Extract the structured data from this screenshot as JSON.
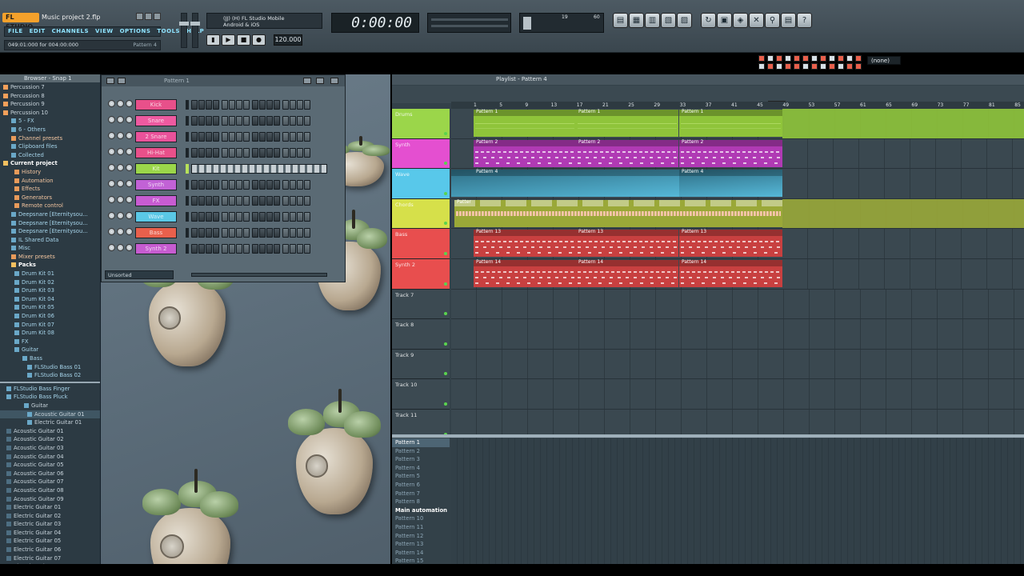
{
  "app": {
    "logo": "FL STUDIO",
    "project_title": "Music project 2.flp",
    "menu": [
      "FILE",
      "EDIT",
      "CHANNELS",
      "VIEW",
      "OPTIONS",
      "TOOLS",
      "HELP"
    ],
    "hint": "049:01:000 for 004:00:000",
    "hint_right": "Pattern 4"
  },
  "transport": {
    "device": "(JJ) (H) FL Studio Mobile\nAndroid & iOS",
    "tempo": "120.000",
    "time": "0:00:00",
    "cpu_left": "19",
    "cpu_right": "60"
  },
  "toolbar": {
    "icons": [
      "piano-icon",
      "mixer-icon",
      "channel-icon",
      "step-icon",
      "playlist-icon",
      "undo-icon",
      "save-icon",
      "plugin-icon",
      "tools-icon",
      "search-icon",
      "clipboard-icon",
      "help-icon"
    ],
    "glyphs": [
      "▤",
      "▦",
      "▥",
      "▧",
      "▨",
      "↻",
      "▣",
      "◈",
      "✕",
      "⚲",
      "▤",
      "?"
    ]
  },
  "snap": {
    "value": "(none)"
  },
  "browser": {
    "header": "Browser - Snap 1",
    "items": [
      {
        "label": "Percussion 7",
        "style": "file"
      },
      {
        "label": "Percussion 8",
        "style": "file"
      },
      {
        "label": "Percussion 9",
        "style": "file"
      },
      {
        "label": "Percussion 10",
        "style": "file"
      },
      {
        "label": "5 - FX",
        "style": "dark"
      },
      {
        "label": "6 - Others",
        "style": "dark"
      },
      {
        "label": "Channel presets",
        "style": "hl"
      },
      {
        "label": "Clipboard files",
        "style": "dark"
      },
      {
        "label": "Collected",
        "style": "dark"
      },
      {
        "label": "Current project",
        "style": "bold"
      },
      {
        "label": "History",
        "style": "hl"
      },
      {
        "label": "Automation",
        "style": "hl"
      },
      {
        "label": "Effects",
        "style": "hl"
      },
      {
        "label": "Generators",
        "style": "hl"
      },
      {
        "label": "Remote control",
        "style": "hl"
      },
      {
        "label": "Deepsnare [Eternitysou...",
        "style": "dark"
      },
      {
        "label": "Deepsnare [Eternitysou...",
        "style": "dark"
      },
      {
        "label": "Deepsnare [Eternitysou...",
        "style": "dark"
      },
      {
        "label": "IL Shared Data",
        "style": "dark"
      },
      {
        "label": "Misc",
        "style": "dark"
      },
      {
        "label": "Mixer presets",
        "style": "hl"
      },
      {
        "label": "Packs",
        "style": "bold"
      },
      {
        "label": "Drum Kit 01",
        "style": "dark"
      },
      {
        "label": "Drum Kit 02",
        "style": "dark"
      },
      {
        "label": "Drum Kit 03",
        "style": "dark"
      },
      {
        "label": "Drum Kit 04",
        "style": "dark"
      },
      {
        "label": "Drum Kit 05",
        "style": "dark"
      },
      {
        "label": "Drum Kit 06",
        "style": "dark"
      },
      {
        "label": "Drum Kit 07",
        "style": "dark"
      },
      {
        "label": "Drum Kit 08",
        "style": "dark"
      },
      {
        "label": "FX",
        "style": "dark"
      },
      {
        "label": "Guitar",
        "style": "dark"
      },
      {
        "label": "Bass",
        "style": "dark"
      },
      {
        "label": "FLStudio Bass 01",
        "style": "dark"
      },
      {
        "label": "FLStudio Bass 02",
        "style": "dark"
      }
    ],
    "items2": [
      "FLStudio Bass Finger",
      "FLStudio Bass Pluck",
      "Guitar",
      "Acoustic Guitar 01",
      "Electric Guitar 01",
      "Acoustic Guitar 01",
      "Acoustic Guitar 02",
      "Acoustic Guitar 03",
      "Acoustic Guitar 04",
      "Acoustic Guitar 05",
      "Acoustic Guitar 06",
      "Acoustic Guitar 07",
      "Acoustic Guitar 08",
      "Acoustic Guitar 09",
      "Electric Guitar 01",
      "Electric Guitar 02",
      "Electric Guitar 03",
      "Electric Guitar 04",
      "Electric Guitar 05",
      "Electric Guitar 06",
      "Electric Guitar 07",
      "Electric Guitar 08",
      "Electric Guitar 09"
    ]
  },
  "rack": {
    "title": "Pattern 1",
    "footer": "Unsorted",
    "channels": [
      {
        "name": "Kick",
        "color": "#e8508a"
      },
      {
        "name": "Snare",
        "color": "#ee5aa0"
      },
      {
        "name": "2 Snare",
        "color": "#e9529a"
      },
      {
        "name": "Hi-Hat",
        "color": "#e8508a"
      },
      {
        "name": "Kit",
        "color": "#9bd64a"
      },
      {
        "name": "Synth",
        "color": "#c262d6"
      },
      {
        "name": "FX",
        "color": "#c85cd2"
      },
      {
        "name": "Wave",
        "color": "#5ac8e6"
      },
      {
        "name": "Bass",
        "color": "#e8604c"
      },
      {
        "name": "Synth 2",
        "color": "#c65cd0"
      }
    ]
  },
  "playlist": {
    "title": "Playlist - Pattern 4",
    "ruler": [
      "1",
      "5",
      "9",
      "13",
      "17",
      "21",
      "25",
      "29",
      "33",
      "37",
      "41",
      "45",
      "49",
      "53",
      "57",
      "61",
      "65",
      "69",
      "73",
      "77",
      "81",
      "85"
    ],
    "tracks": [
      {
        "name": "Drums",
        "color": "#9bd64a",
        "lane": "#8fc43a",
        "clips": [
          {
            "label": "Pattern 1"
          },
          {
            "label": "Pattern 1"
          },
          {
            "label": "Pattern 1"
          }
        ],
        "kind": "wave"
      },
      {
        "name": "Synth",
        "color": "#e44fd0",
        "lane": "#b03ab4",
        "clips": [
          {
            "label": "Pattern 2"
          },
          {
            "label": "Pattern 2"
          },
          {
            "label": "Pattern 2"
          }
        ],
        "kind": "notes"
      },
      {
        "name": "Wave",
        "color": "#58c8ea",
        "lane": "#4fa6c2",
        "clips": [
          {
            "label": "Pattern 4"
          },
          {
            "label": "Pattern 4"
          }
        ],
        "kind": "auto"
      },
      {
        "name": "Chords",
        "color": "#d6e04a",
        "lane": "#9aa838",
        "clips": [
          {
            "label": "Patter"
          }
        ],
        "kind": "dense"
      },
      {
        "name": "Bass",
        "color": "#e84e4e",
        "lane": "#c84040",
        "clips": [
          {
            "label": "Pattern 13"
          },
          {
            "label": "Pattern 13"
          },
          {
            "label": "Pattern 13"
          }
        ],
        "kind": "notes"
      },
      {
        "name": "Synth 2",
        "color": "#e84e4e",
        "lane": "#c84040",
        "clips": [
          {
            "label": "Pattern 14"
          },
          {
            "label": "Pattern 14"
          },
          {
            "label": "Pattern 14"
          }
        ],
        "kind": "notes"
      },
      {
        "name": "Track 7",
        "color": "#3c4a52",
        "lane": "",
        "clips": [],
        "kind": "empty"
      },
      {
        "name": "Track 8",
        "color": "#3c4a52",
        "lane": "",
        "clips": [],
        "kind": "empty"
      },
      {
        "name": "Track 9",
        "color": "#3c4a52",
        "lane": "",
        "clips": [],
        "kind": "empty"
      },
      {
        "name": "Track 10",
        "color": "#3c4a52",
        "lane": "",
        "clips": [],
        "kind": "empty"
      },
      {
        "name": "Track 11",
        "color": "#3c4a52",
        "lane": "",
        "clips": [],
        "kind": "empty"
      }
    ],
    "patterns": [
      {
        "label": "Pattern 1",
        "style": "sel"
      },
      {
        "label": "Pattern 2",
        "style": ""
      },
      {
        "label": "Pattern 3",
        "style": ""
      },
      {
        "label": "Pattern 4",
        "style": ""
      },
      {
        "label": "Pattern 5",
        "style": ""
      },
      {
        "label": "Pattern 6",
        "style": ""
      },
      {
        "label": "Pattern 7",
        "style": ""
      },
      {
        "label": "Pattern 8",
        "style": ""
      },
      {
        "label": "Main automation",
        "style": "bold"
      },
      {
        "label": "Pattern 10",
        "style": ""
      },
      {
        "label": "Pattern 11",
        "style": ""
      },
      {
        "label": "Pattern 12",
        "style": ""
      },
      {
        "label": "Pattern 13",
        "style": ""
      },
      {
        "label": "Pattern 14",
        "style": ""
      },
      {
        "label": "Pattern 15",
        "style": ""
      }
    ]
  }
}
